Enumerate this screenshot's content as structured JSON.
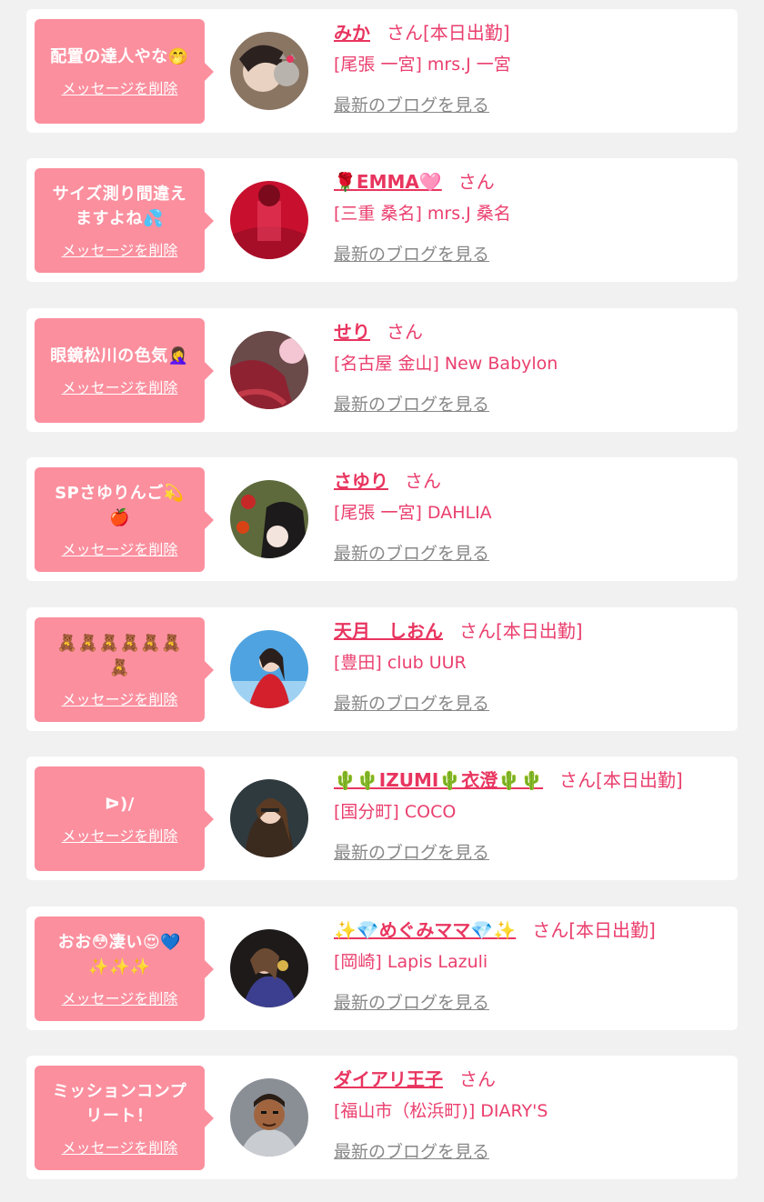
{
  "accent_color": "#e8355f",
  "bubble_color": "#fb8f9e",
  "delete_label": "メッセージを削除",
  "blog_label": "最新のブログを見る",
  "items": [
    {
      "message": "配置の達人やな🤭",
      "name": "みか",
      "suffix": "さん[本日出勤]",
      "shop": "[尾張 一宮] mrs.J 一宮"
    },
    {
      "message": "サイズ測り間違え\nますよね💦",
      "name": "🌹EMMA🩷",
      "suffix": "さん",
      "shop": "[三重 桑名] mrs.J 桑名"
    },
    {
      "message": "眼鏡松川の色気🤦‍♀️",
      "name": "せり",
      "suffix": "さん",
      "shop": "[名古屋 金山] New Babylon"
    },
    {
      "message": "SPさゆりんご💫\n🍎",
      "name": "さゆり",
      "suffix": "さん",
      "shop": "[尾張 一宮] DAHLIA"
    },
    {
      "message": "🧸🧸🧸🧸🧸🧸\n🧸",
      "name": "天月　しおん",
      "suffix": "さん[本日出勤]",
      "shop": "[豊田] club UUR"
    },
    {
      "message": "ᐅ)/",
      "name": "🌵🌵IZUMI🌵衣澄🌵🌵",
      "suffix": "さん[本日出勤]",
      "shop": "[国分町] COCO"
    },
    {
      "message": "おお😳凄い😍💙\n✨✨✨",
      "name": "✨💎めぐみママ💎✨",
      "suffix": "さん[本日出勤]",
      "shop": "[岡崎] Lapis Lazuli"
    },
    {
      "message": "ミッションコンプ\nリート！",
      "name": "ダイアリ王子",
      "suffix": "さん",
      "shop": "[福山市（松浜町)] DIARY'S"
    }
  ]
}
